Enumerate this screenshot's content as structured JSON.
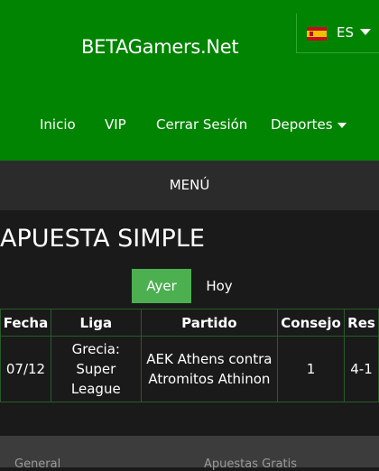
{
  "header": {
    "site_title": "BETAGamers.Net",
    "language": {
      "code": "ES",
      "flag": "spain-flag"
    },
    "nav": [
      "Inicio",
      "VIP",
      "Cerrar Sesión",
      "Deportes"
    ]
  },
  "menu_label": "MENÚ",
  "section_title": "APUESTA SIMPLE",
  "tabs": [
    {
      "label": "Ayer",
      "active": true
    },
    {
      "label": "Hoy",
      "active": false
    }
  ],
  "table": {
    "headers": [
      "Fecha",
      "Liga",
      "Partido",
      "Consejo",
      "Res"
    ],
    "rows": [
      [
        "07/12",
        "Grecia: Super League",
        "AEK Athens contra Atromitos Athinon",
        "1",
        "4-1"
      ]
    ]
  },
  "footer": [
    "General",
    "Apuestas Gratis"
  ],
  "colors": {
    "header": "#018401",
    "tab_active": "#4caf50",
    "menu_bar": "#2b2b2b",
    "background": "#1a1a1a"
  }
}
